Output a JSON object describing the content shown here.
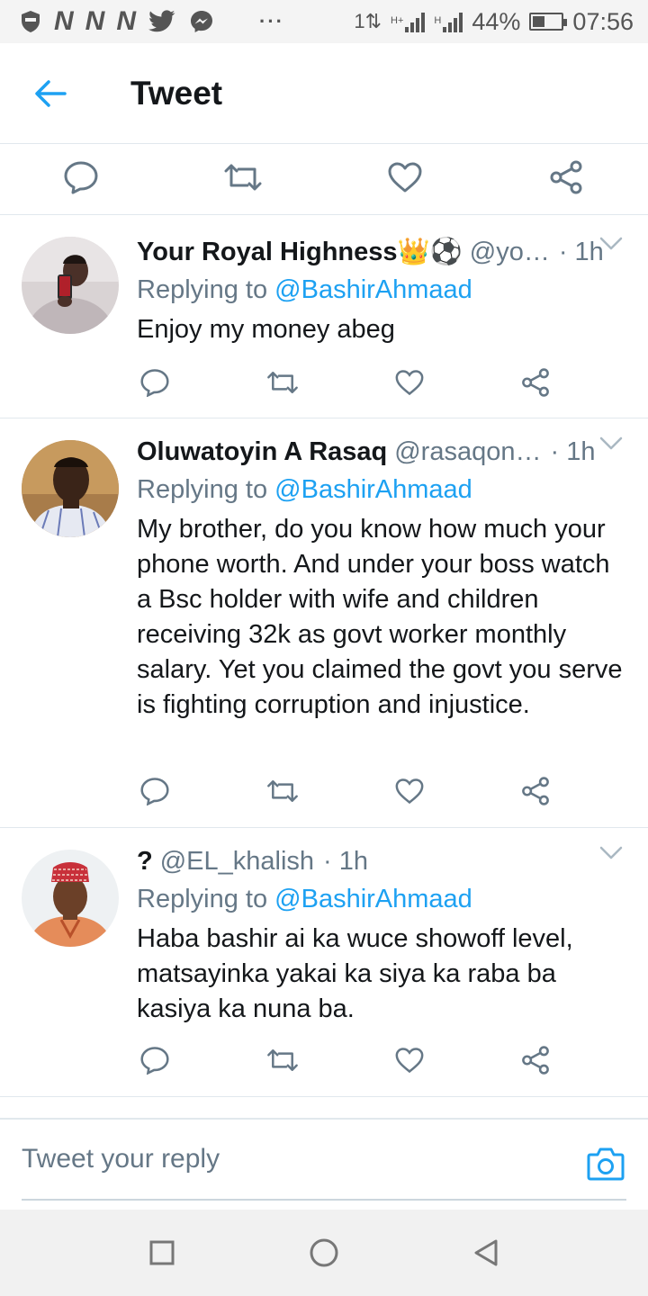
{
  "status_bar": {
    "notification_n": "N",
    "more": "···",
    "network": "1⇅",
    "net_h1": "H+",
    "net_h2": "H",
    "battery": "44%",
    "battery_level": 0.44,
    "time": "07:56"
  },
  "header": {
    "title": "Tweet"
  },
  "compose": {
    "placeholder": "Tweet your reply"
  },
  "replies": [
    {
      "name": "Your Royal Highness👑⚽",
      "handle": "@yo…",
      "time": "· 1h",
      "replying_prefix": "Replying to",
      "replying_to": "@BashirAhmaad",
      "text": "Enjoy my money abeg"
    },
    {
      "name": "Oluwatoyin A Rasaq",
      "handle": "@rasaqon…",
      "time": "· 1h",
      "replying_prefix": "Replying to",
      "replying_to": "@BashirAhmaad",
      "text": "My brother, do you know how much your phone worth. And under your boss watch a Bsc holder with wife and children receiving 32k as govt worker monthly salary. Yet you claimed the govt you serve is fighting corruption and injustice."
    },
    {
      "name": "?",
      "handle": "@EL_khalish",
      "time": "· 1h",
      "replying_prefix": "Replying to",
      "replying_to": "@BashirAhmaad",
      "text": "Haba bashir ai ka wuce showoff level, matsayinka yakai ka siya ka raba ba kasiya ka nuna ba."
    }
  ],
  "colors": {
    "accent": "#1da1f2",
    "secondary_text": "#657786",
    "icon": "#657786"
  }
}
